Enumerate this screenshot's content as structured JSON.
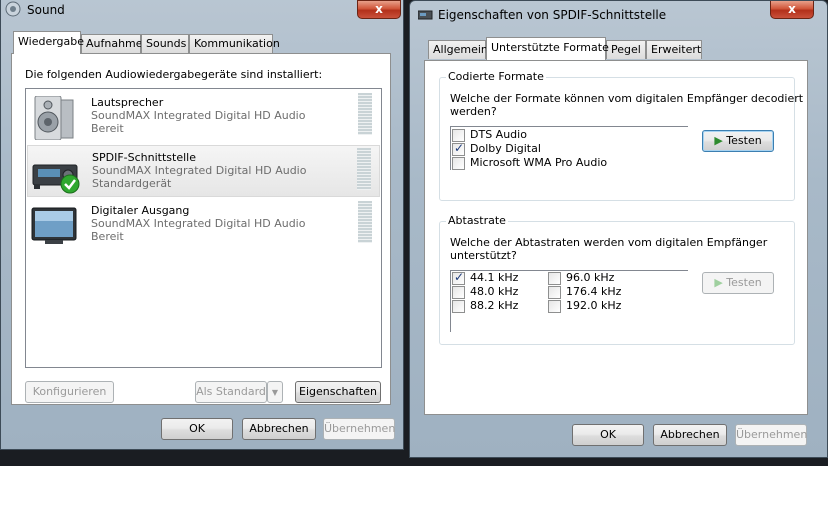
{
  "sound_window": {
    "title": "Sound",
    "close_label": "x",
    "tabs": [
      {
        "label": "Wiedergabe"
      },
      {
        "label": "Aufnahme"
      },
      {
        "label": "Sounds"
      },
      {
        "label": "Kommunikation"
      }
    ],
    "instruction": "Die folgenden Audiowiedergabegeräte sind installiert:",
    "devices": [
      {
        "name": "Lautsprecher",
        "driver": "SoundMAX Integrated Digital HD Audio",
        "status": "Bereit",
        "icon": "speaker-icon"
      },
      {
        "name": "SPDIF-Schnittstelle",
        "driver": "SoundMAX Integrated Digital HD Audio",
        "status": "Standardgerät",
        "icon": "spdif-receiver-icon"
      },
      {
        "name": "Digitaler Ausgang",
        "driver": "SoundMAX Integrated Digital HD Audio",
        "status": "Bereit",
        "icon": "monitor-icon"
      }
    ],
    "configure_label": "Konfigurieren",
    "set_default_label": "Als Standard",
    "properties_label": "Eigenschaften",
    "ok_label": "OK",
    "cancel_label": "Abbrechen",
    "apply_label": "Übernehmen"
  },
  "props_window": {
    "title": "Eigenschaften von SPDIF-Schnittstelle",
    "close_label": "x",
    "tabs": [
      {
        "label": "Allgemein"
      },
      {
        "label": "Unterstützte Formate"
      },
      {
        "label": "Pegel"
      },
      {
        "label": "Erweitert"
      }
    ],
    "encoded": {
      "title": "Codierte Formate",
      "question": "Welche der Formate können vom digitalen Empfänger decodiert",
      "question_line2": "werden?",
      "formats": [
        {
          "label": "DTS Audio",
          "checked": false
        },
        {
          "label": "Dolby Digital",
          "checked": true
        },
        {
          "label": "Microsoft WMA Pro Audio",
          "checked": false
        }
      ],
      "test_label": "Testen"
    },
    "sample_rate": {
      "title": "Abtastrate",
      "question": "Welche der Abtastraten werden vom digitalen Empfänger",
      "question_line2": "unterstützt?",
      "rates_left": [
        {
          "label": "44.1 kHz",
          "checked": true
        },
        {
          "label": "48.0 kHz",
          "checked": false
        },
        {
          "label": "88.2 kHz",
          "checked": false
        }
      ],
      "rates_right": [
        {
          "label": "96.0 kHz",
          "checked": false
        },
        {
          "label": "176.4 kHz",
          "checked": false
        },
        {
          "label": "192.0 kHz",
          "checked": false
        }
      ],
      "test_label": "Testen"
    },
    "ok_label": "OK",
    "cancel_label": "Abbrechen",
    "apply_label": "Übernehmen"
  },
  "colors": {
    "desktop": "#1a1d22",
    "window_frame": "#a8b9c8",
    "close_button": "#c9503a",
    "play_icon": "#2e8b2e",
    "checkmark_badge": "#2fa82f"
  }
}
